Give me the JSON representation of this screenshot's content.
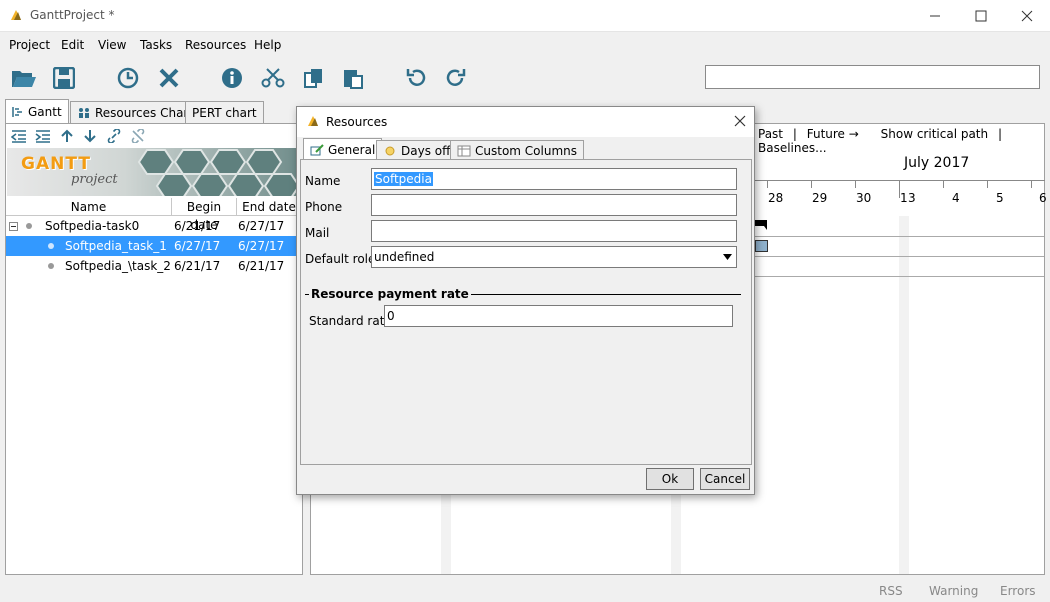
{
  "window": {
    "title": "GanttProject *"
  },
  "menu": [
    "Project",
    "Edit",
    "View",
    "Tasks",
    "Resources",
    "Help"
  ],
  "tabs": [
    {
      "label": "Gantt",
      "icon": "gantt-icon"
    },
    {
      "label": "Resources Chart",
      "icon": "resources-icon"
    },
    {
      "label": "PERT chart",
      "icon": ""
    }
  ],
  "banner": {
    "line1": "GANTT",
    "line2": "project"
  },
  "table": {
    "headers": [
      "Name",
      "Begin date",
      "End date"
    ],
    "rows": [
      {
        "name": "Softpedia-task0",
        "begin": "6/21/17",
        "end": "6/27/17"
      },
      {
        "name": "Softpedia_task_1",
        "begin": "6/27/17",
        "end": "6/27/17"
      },
      {
        "name": "Softpedia_\\task_2",
        "begin": "6/21/17",
        "end": "6/21/17"
      }
    ]
  },
  "gantt": {
    "nav_past": "Past",
    "nav_sep1": "|",
    "nav_future": "Future →",
    "nav_critical": "Show critical path",
    "nav_sep2": "|",
    "nav_baselines": "Baselines...",
    "month": "July 2017",
    "days": [
      "28",
      "29",
      "30",
      "1",
      "3",
      "4",
      "5",
      "6"
    ]
  },
  "dialog": {
    "title": "Resources",
    "tabs": [
      "General",
      "Days off",
      "Custom Columns"
    ],
    "fields": {
      "name_label": "Name",
      "name_value": "Softpedia",
      "phone_label": "Phone",
      "phone_value": "",
      "mail_label": "Mail",
      "mail_value": "",
      "role_label": "Default role",
      "role_value": "undefined"
    },
    "payment": {
      "section_label": "Resource payment rate",
      "rate_label": "Standard rate",
      "rate_value": "0"
    },
    "ok": "Ok",
    "cancel": "Cancel"
  },
  "status": [
    "RSS",
    "Warning",
    "Errors"
  ],
  "colors": {
    "selection": "#3399ff",
    "accent": "#f39c12"
  }
}
